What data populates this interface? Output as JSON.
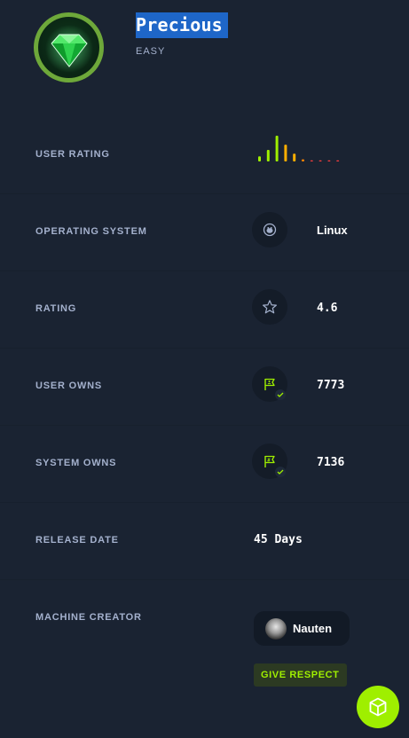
{
  "machine": {
    "name": "Precious",
    "difficulty": "EASY",
    "logo_icon": "green-gem-icon"
  },
  "stats": {
    "user_rating": {
      "label": "USER RATING",
      "bars": [
        {
          "value": 0.2,
          "color": "#9fef00"
        },
        {
          "value": 0.45,
          "color": "#9fef00"
        },
        {
          "value": 1.0,
          "color": "#9fef00"
        },
        {
          "value": 0.65,
          "color": "#ffaf00"
        },
        {
          "value": 0.3,
          "color": "#ffaf00"
        },
        {
          "value": 0.08,
          "color": "#ff8400"
        },
        {
          "value": 0.0,
          "color": "#ff3e3e"
        },
        {
          "value": 0.0,
          "color": "#ff3e3e"
        },
        {
          "value": 0.0,
          "color": "#ff3e3e"
        },
        {
          "value": 0.0,
          "color": "#ff3e3e"
        }
      ]
    },
    "os": {
      "label": "OPERATING SYSTEM",
      "value": "Linux",
      "icon": "linux-icon"
    },
    "rating": {
      "label": "RATING",
      "value": "4.6",
      "icon": "star-icon"
    },
    "user_owns": {
      "label": "USER OWNS",
      "value": "7773",
      "icon": "user-flag-icon"
    },
    "system_owns": {
      "label": "SYSTEM OWNS",
      "value": "7136",
      "icon": "system-flag-icon"
    },
    "release_date": {
      "label": "RELEASE DATE",
      "value": "45 Days"
    },
    "creator": {
      "label": "MACHINE CREATOR",
      "name": "Nauten",
      "icon": "avatar"
    }
  },
  "actions": {
    "give_respect": "GIVE RESPECT",
    "fab_icon": "cube-icon"
  },
  "colors": {
    "background": "#1a2332",
    "accent": "#9fef00",
    "title_highlight": "#1e66c8"
  }
}
